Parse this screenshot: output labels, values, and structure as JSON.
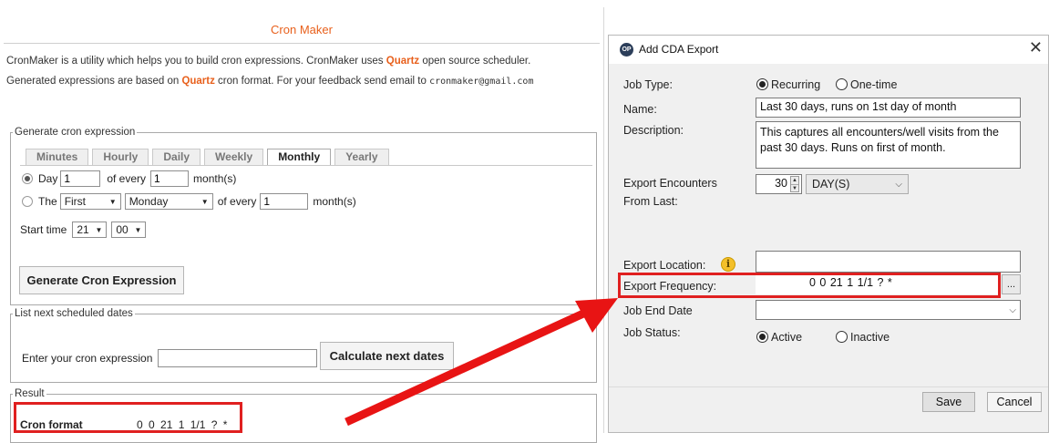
{
  "cronmaker": {
    "title": "Cron Maker",
    "intro1_pre": "CronMaker is a utility which helps you to build cron expressions. CronMaker uses ",
    "intro1_quartz": "Quartz",
    "intro1_post": " open source scheduler.",
    "intro2_pre": "Generated expressions are based on ",
    "intro2_quartz": "Quartz",
    "intro2_mid": " cron format. For your feedback send email to ",
    "intro2_email": "cronmaker@gmail.com",
    "generate": {
      "legend": "Generate cron expression",
      "tabs": [
        "Minutes",
        "Hourly",
        "Daily",
        "Weekly",
        "Monthly",
        "Yearly"
      ],
      "active_tab": "Monthly",
      "day_label": "Day",
      "day_value": "1",
      "of_every_label": "of every",
      "month_value_1": "1",
      "months_label": "month(s)",
      "the_label": "The",
      "first_option": "First",
      "weekday_option": "Monday",
      "of_every_label_2": "of every",
      "month_value_2": "1",
      "months_label_2": "month(s)",
      "start_time_label": "Start time",
      "start_hour": "21",
      "start_minute": "00",
      "button": "Generate Cron Expression"
    },
    "scheduled": {
      "legend": "List next scheduled dates",
      "input_label": "Enter your cron expression",
      "input_value": "",
      "button": "Calculate next dates"
    },
    "result": {
      "legend": "Result",
      "label": "Cron format",
      "value": "0 0 21 1 1/1 ? *"
    }
  },
  "dialog": {
    "title": "Add CDA Export",
    "logo_text": "OP",
    "close": "✕",
    "job_type_label": "Job Type:",
    "job_type_options": [
      "Recurring",
      "One-time"
    ],
    "job_type_selected": "Recurring",
    "name_label": "Name:",
    "name_value": "Last 30 days, runs on 1st day of month",
    "description_label": "Description:",
    "description_value": "This captures all encounters/well visits from the past 30 days. Runs on first of month.",
    "export_encounters_label_1": "Export Encounters",
    "export_encounters_label_2": "From Last:",
    "export_encounters_value": "30",
    "export_encounters_unit": "DAY(S)",
    "export_location_label": "Export Location:",
    "export_location_value": "",
    "export_frequency_label": "Export Frequency:",
    "export_frequency_value": "0 0 21 1 1/1 ? *",
    "ellipsis": "...",
    "job_end_date_label": "Job End Date",
    "job_end_date_value": "",
    "job_status_label": "Job Status:",
    "job_status_options": [
      "Active",
      "Inactive"
    ],
    "job_status_selected": "Active",
    "save_button": "Save",
    "cancel_button": "Cancel"
  },
  "colors": {
    "quartz_orange": "#e8601c",
    "highlight_red": "#e02020",
    "dialog_bg": "#f0f0f0"
  },
  "icons": {
    "info": "info-icon",
    "close": "close-icon",
    "arrow": "annotation-arrow"
  }
}
